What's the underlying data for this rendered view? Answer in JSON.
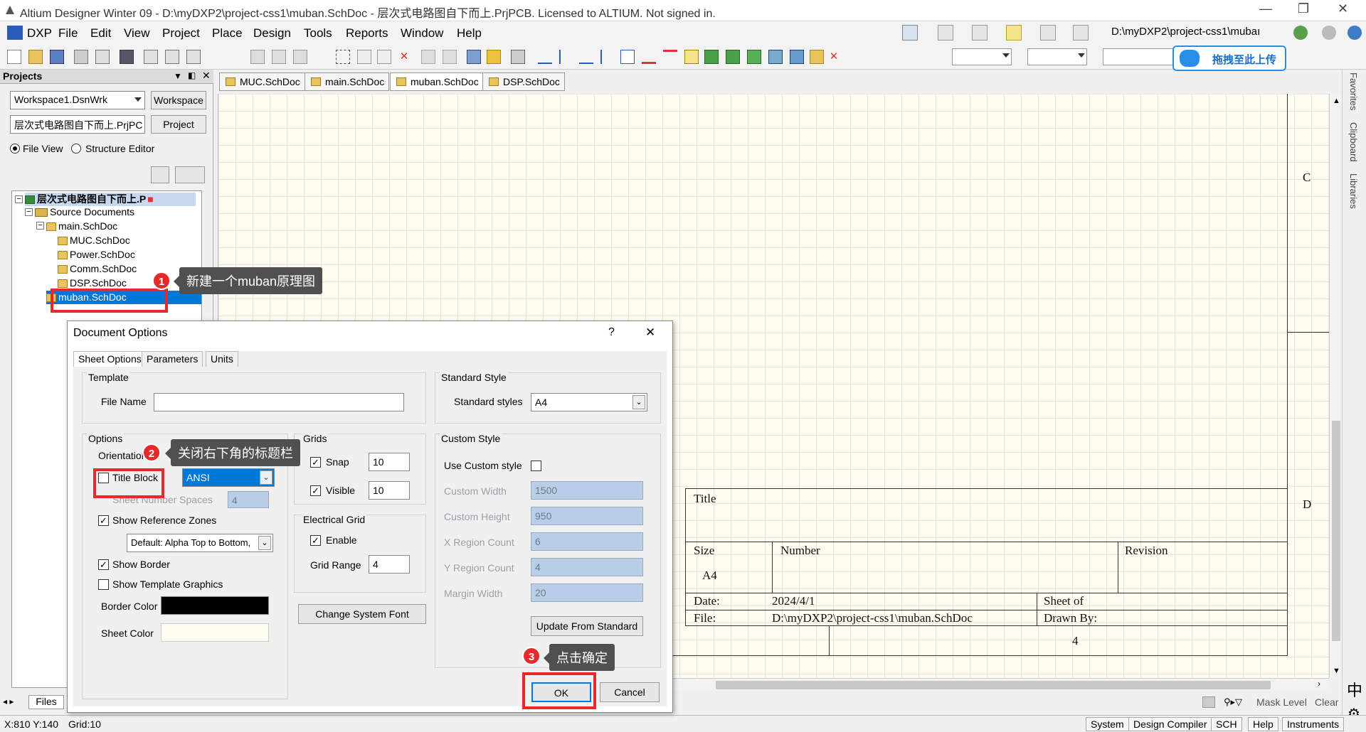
{
  "window": {
    "title": "Altium Designer Winter 09 - D:\\myDXP2\\project-css1\\muban.SchDoc - 层次式电路图自下而上.PrjPCB. Licensed to ALTIUM. Not signed in."
  },
  "menu": {
    "dxp": "DXP",
    "items": [
      "File",
      "Edit",
      "View",
      "Project",
      "Place",
      "Design",
      "Tools",
      "Reports",
      "Window",
      "Help"
    ],
    "path": "D:\\myDXP2\\project-css1\\mubaı"
  },
  "upload_button": "拖拽至此上传",
  "panel": {
    "title": "Projects",
    "workspace_value": "Workspace1.DsnWrk",
    "workspace_btn": "Workspace",
    "project_value": "层次式电路图自下而上.PrjPC",
    "project_btn": "Project",
    "file_view": "File View",
    "structure_editor": "Structure Editor",
    "files_tab": "Files"
  },
  "tree": {
    "project": "层次式电路图自下而上.P",
    "source_documents": "Source Documents",
    "items": [
      "main.SchDoc",
      "MUC.SchDoc",
      "Power.SchDoc",
      "Comm.SchDoc",
      "DSP.SchDoc",
      "muban.SchDoc"
    ]
  },
  "tabs": [
    "MUC.SchDoc",
    "main.SchDoc",
    "muban.SchDoc",
    "DSP.SchDoc"
  ],
  "sheet": {
    "zone_c": "C",
    "zone_d": "D",
    "title": "Title",
    "size_label": "Size",
    "size_value": "A4",
    "number_label": "Number",
    "revision_label": "Revision",
    "date_label": "Date:",
    "date_value": "2024/4/1",
    "sheet_label": "Sheet   of",
    "file_label": "File:",
    "file_value": "D:\\myDXP2\\project-css1\\muban.SchDoc",
    "drawn_by": "Drawn By:",
    "zone_4": "4"
  },
  "dialog": {
    "title": "Document Options",
    "help": "?",
    "close": "✕",
    "tabs": [
      "Sheet Options",
      "Parameters",
      "Units"
    ],
    "template": {
      "group": "Template",
      "file_name_label": "File Name",
      "file_name_value": ""
    },
    "standard": {
      "group": "Standard Style",
      "label": "Standard styles",
      "value": "A4"
    },
    "options": {
      "group": "Options",
      "orientation_label": "Orientation",
      "title_block_label": "Title Block",
      "title_block_value": "ANSI",
      "sheet_number_spaces_label": "Sheet Number Spaces",
      "sheet_number_spaces_value": "4",
      "show_reference_zones": "Show Reference Zones",
      "zones_style": "Default: Alpha Top to Bottom,",
      "show_border": "Show Border",
      "show_template_graphics": "Show Template Graphics",
      "border_color_label": "Border Color",
      "sheet_color_label": "Sheet Color",
      "border_color": "#000000",
      "sheet_color": "#fffdf2"
    },
    "grids": {
      "group": "Grids",
      "snap_label": "Snap",
      "snap_value": "10",
      "visible_label": "Visible",
      "visible_value": "10"
    },
    "electrical": {
      "group": "Electrical Grid",
      "enable_label": "Enable",
      "range_label": "Grid Range",
      "range_value": "4"
    },
    "change_font": "Change System Font",
    "custom": {
      "group": "Custom Style",
      "use_label": "Use Custom style",
      "width_label": "Custom Width",
      "width_value": "1500",
      "height_label": "Custom Height",
      "height_value": "950",
      "xregion_label": "X Region Count",
      "xregion_value": "6",
      "yregion_label": "Y Region Count",
      "yregion_value": "4",
      "margin_label": "Margin Width",
      "margin_value": "20",
      "update_btn": "Update From Standard"
    },
    "ok": "OK",
    "cancel": "Cancel"
  },
  "annotations": {
    "step1": "新建一个muban原理图",
    "step2": "关闭右下角的标题栏",
    "step3": "点击确定",
    "n1": "1",
    "n2": "2",
    "n3": "3"
  },
  "status": {
    "coords": "X:810 Y:140",
    "grid": "Grid:10",
    "mask_level": "Mask Level",
    "clear": "Clear",
    "buttons": [
      "System",
      "Design Compiler",
      "SCH",
      "Help",
      "Instruments"
    ],
    "ime": "中"
  },
  "sidebar": {
    "favorites": "Favorites",
    "clipboard": "Clipboard",
    "libraries": "Libraries"
  },
  "colors": {
    "accent": "#e8292b",
    "selection": "#0078d7",
    "disabled_field": "#b9cde6"
  }
}
